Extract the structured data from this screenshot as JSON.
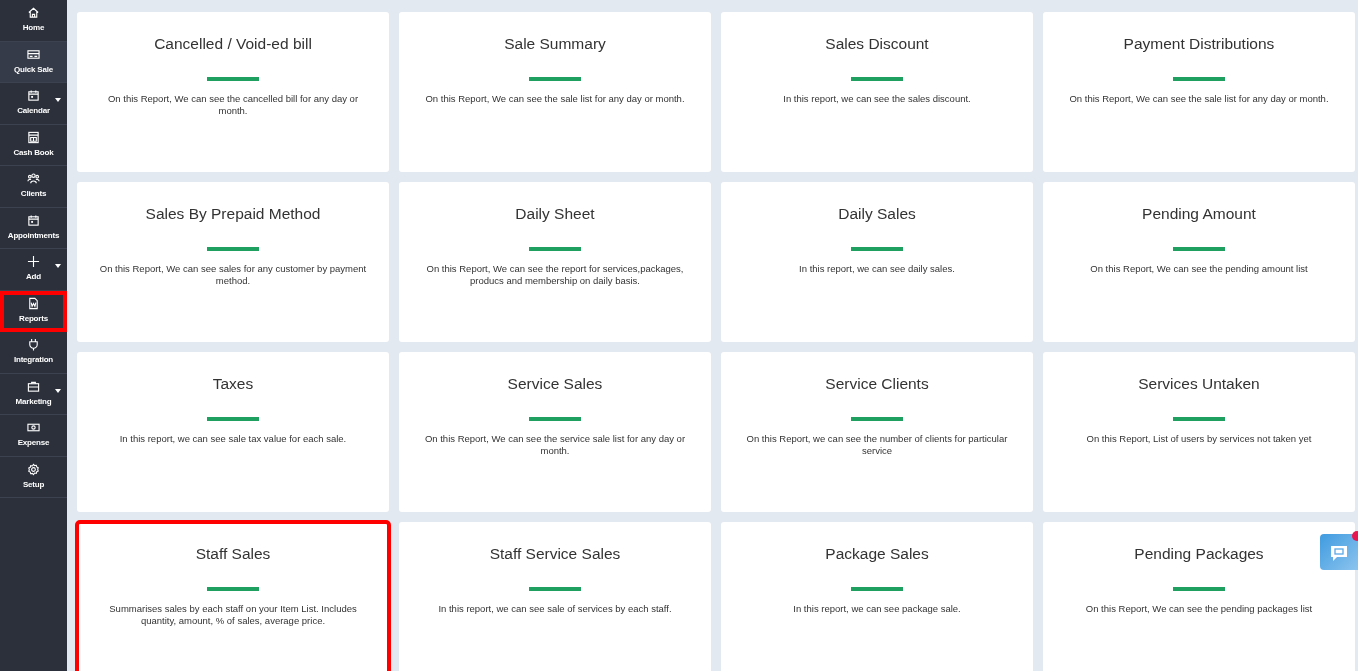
{
  "sidebar": {
    "items": [
      {
        "label": "Home",
        "kind": "home",
        "selected": false,
        "highlighted": false,
        "dropdown": false
      },
      {
        "label": "Quick Sale",
        "kind": "card",
        "selected": true,
        "highlighted": false,
        "dropdown": false
      },
      {
        "label": "Calendar",
        "kind": "calendar",
        "selected": false,
        "highlighted": false,
        "dropdown": true
      },
      {
        "label": "Cash Book",
        "kind": "book",
        "selected": false,
        "highlighted": false,
        "dropdown": false
      },
      {
        "label": "Clients",
        "kind": "people",
        "selected": false,
        "highlighted": false,
        "dropdown": false
      },
      {
        "label": "Appointments",
        "kind": "calendar",
        "selected": false,
        "highlighted": false,
        "dropdown": false
      },
      {
        "label": "Add",
        "kind": "plus",
        "selected": false,
        "highlighted": false,
        "dropdown": true
      },
      {
        "label": "Reports",
        "kind": "doc",
        "selected": false,
        "highlighted": true,
        "dropdown": false
      },
      {
        "label": "Integration",
        "kind": "plug",
        "selected": false,
        "highlighted": false,
        "dropdown": false
      },
      {
        "label": "Marketing",
        "kind": "briefcase",
        "selected": false,
        "highlighted": false,
        "dropdown": true
      },
      {
        "label": "Expense",
        "kind": "money",
        "selected": false,
        "highlighted": false,
        "dropdown": false
      },
      {
        "label": "Setup",
        "kind": "gear",
        "selected": false,
        "highlighted": false,
        "dropdown": false
      }
    ]
  },
  "reports": [
    {
      "title": "Cancelled / Void-ed bill",
      "description": "On this Report, We can see the cancelled bill for any day or month.",
      "highlighted": false
    },
    {
      "title": "Sale Summary",
      "description": "On this Report, We can see the sale list for any day or month.",
      "highlighted": false
    },
    {
      "title": "Sales Discount",
      "description": "In this report, we can see the sales discount.",
      "highlighted": false
    },
    {
      "title": "Payment Distributions",
      "description": "On this Report, We can see the sale list for any day or month.",
      "highlighted": false
    },
    {
      "title": "Sales By Prepaid Method",
      "description": "On this Report, We can see sales for any customer by payment method.",
      "highlighted": false
    },
    {
      "title": "Daily Sheet",
      "description": "On this Report, We can see the report for services,packages, producs and membership on daily basis.",
      "highlighted": false
    },
    {
      "title": "Daily Sales",
      "description": "In this report, we can see daily sales.",
      "highlighted": false
    },
    {
      "title": "Pending Amount",
      "description": "On this Report, We can see the pending amount list",
      "highlighted": false
    },
    {
      "title": "Taxes",
      "description": "In this report, we can see sale tax value for each sale.",
      "highlighted": false
    },
    {
      "title": "Service Sales",
      "description": "On this Report, We can see the service sale list for any day or month.",
      "highlighted": false
    },
    {
      "title": "Service Clients",
      "description": "On this Report, we can see the number of clients for particular service",
      "highlighted": false
    },
    {
      "title": "Services Untaken",
      "description": "On this Report, List of users by services not taken yet",
      "highlighted": false
    },
    {
      "title": "Staff Sales",
      "description": "Summarises sales by each staff on your Item List. Includes quantity, amount, % of sales, average price.",
      "highlighted": true
    },
    {
      "title": "Staff Service Sales",
      "description": "In this report, we can see sale of services by each staff.",
      "highlighted": false
    },
    {
      "title": "Package Sales",
      "description": "In this report, we can see package sale.",
      "highlighted": false
    },
    {
      "title": "Pending Packages",
      "description": "On this Report, We can see the pending packages list",
      "highlighted": false
    }
  ],
  "chat_button": {
    "unread": true
  }
}
